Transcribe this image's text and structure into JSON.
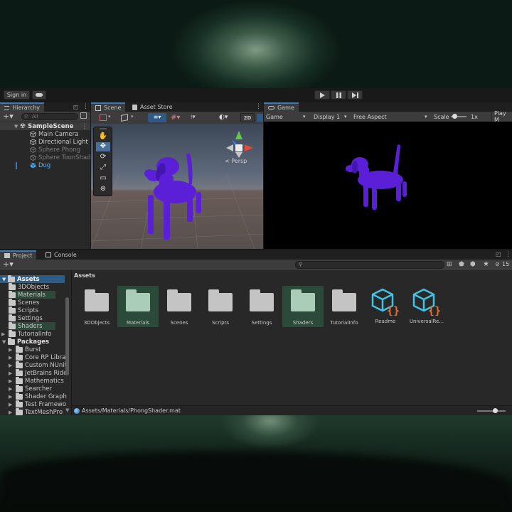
{
  "toolbar": {
    "sign_in": "Sign in"
  },
  "hierarchy": {
    "tab": "Hierarchy",
    "search_placeholder": "All",
    "scene": "SampleScene",
    "items": [
      {
        "label": "Main Camera"
      },
      {
        "label": "Directional Light"
      },
      {
        "label": "Sphere Phong"
      },
      {
        "label": "Sphere ToonShad"
      },
      {
        "label": "Dog"
      }
    ]
  },
  "scene_view": {
    "tab": "Scene",
    "mode_2d": "2D",
    "persp": "< Persp"
  },
  "asset_store": {
    "tab": "Asset Store"
  },
  "game_view": {
    "tab": "Game",
    "mode": "Game",
    "display": "Display 1",
    "aspect": "Free Aspect",
    "scale_label": "Scale",
    "scale_value": "1x",
    "play_mode": "Play M"
  },
  "project": {
    "tab": "Project",
    "console_tab": "Console",
    "hidden_count": "15",
    "tree": [
      {
        "label": "Assets",
        "level": 0,
        "kind": "root",
        "selected": true
      },
      {
        "label": "3DObjects",
        "level": 1
      },
      {
        "label": "Materials",
        "level": 1,
        "highlight": true
      },
      {
        "label": "Scenes",
        "level": 1
      },
      {
        "label": "Scripts",
        "level": 1
      },
      {
        "label": "Settings",
        "level": 1
      },
      {
        "label": "Shaders",
        "level": 1,
        "highlight": true
      },
      {
        "label": "TutorialInfo",
        "level": 1,
        "arrow": true
      },
      {
        "label": "Packages",
        "level": 0,
        "kind": "root"
      },
      {
        "label": "Burst",
        "level": 1,
        "arrow": true
      },
      {
        "label": "Core RP Librar",
        "level": 1,
        "arrow": true
      },
      {
        "label": "Custom NUnit",
        "level": 1,
        "arrow": true
      },
      {
        "label": "JetBrains Ride",
        "level": 1,
        "arrow": true
      },
      {
        "label": "Mathematics",
        "level": 1,
        "arrow": true
      },
      {
        "label": "Searcher",
        "level": 1,
        "arrow": true
      },
      {
        "label": "Shader Graph",
        "level": 1,
        "arrow": true
      },
      {
        "label": "Test Framewo",
        "level": 1,
        "arrow": true
      },
      {
        "label": "TextMeshPro",
        "level": 1,
        "arrow": true
      }
    ],
    "breadcrumb": "Assets",
    "assets": [
      {
        "label": "3DObjects",
        "kind": "folder"
      },
      {
        "label": "Materials",
        "kind": "folder",
        "selected": true
      },
      {
        "label": "Scenes",
        "kind": "folder"
      },
      {
        "label": "Scripts",
        "kind": "folder"
      },
      {
        "label": "Settings",
        "kind": "folder"
      },
      {
        "label": "Shaders",
        "kind": "folder",
        "selected": true
      },
      {
        "label": "TutorialInfo",
        "kind": "folder"
      },
      {
        "label": "Readme",
        "kind": "asset"
      },
      {
        "label": "UniversalRe...",
        "kind": "asset"
      }
    ],
    "status_path": "Assets/Materials/PhongShader.mat"
  },
  "colors": {
    "accent": "#3a79bb",
    "dog": "#5a1fd6",
    "selection": "#2c5d87",
    "folder": "#c4c4c4",
    "folder_selected": "#a9cdb6",
    "asset_cyan": "#3fc3e6",
    "asset_orange": "#f36c2c"
  }
}
